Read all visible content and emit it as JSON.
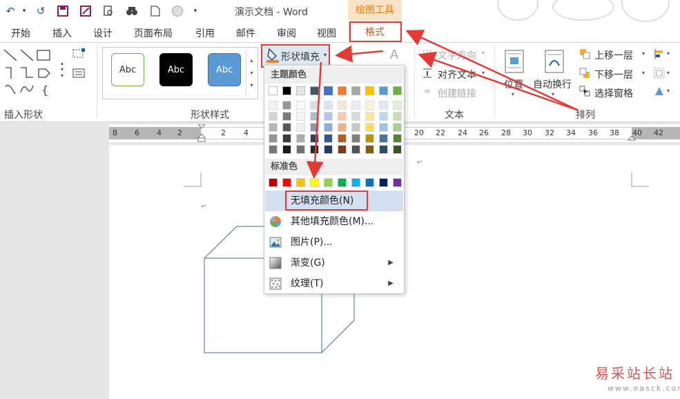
{
  "window": {
    "title": "演示文档 - Word",
    "context_tab_group": "绘图工具"
  },
  "tabs": [
    "开始",
    "插入",
    "设计",
    "页面布局",
    "引用",
    "邮件",
    "审阅",
    "视图",
    "格式"
  ],
  "ribbon": {
    "insert_shapes_label": "插入形状",
    "shape_styles_label": "形状样式",
    "style_samples": [
      "Abc",
      "Abc",
      "Abc"
    ],
    "shape_fill_label": "形状填充",
    "text_direction_label": "文字方向",
    "align_text_label": "对齐文本",
    "create_link_label": "创建链接",
    "text_group_label": "文本",
    "position_label": "位置",
    "wrap_text_label": "自动换行",
    "bring_forward_label": "上移一层",
    "send_backward_label": "下移一层",
    "selection_pane_label": "选择窗格",
    "arrange_group_label": "排列"
  },
  "ruler": {
    "numbers": [
      "8",
      "6",
      "4",
      "2",
      "2",
      "4",
      "20",
      "22",
      "24",
      "26",
      "28",
      "30",
      "32",
      "34",
      "36",
      "38",
      "40",
      "42"
    ]
  },
  "fill_menu": {
    "theme_colors_header": "主题颜色",
    "standard_colors_header": "标准色",
    "theme_top_row": [
      "#ffffff",
      "#000000",
      "#e7e6e6",
      "#44546a",
      "#4472c4",
      "#ed7d31",
      "#a5a5a5",
      "#ffc000",
      "#5b9bd5",
      "#70ad47"
    ],
    "standard_colors": [
      "#c00000",
      "#ff0000",
      "#ffc000",
      "#ffff00",
      "#92d050",
      "#00b050",
      "#00b0f0",
      "#0070c0",
      "#002060",
      "#7030a0"
    ],
    "no_fill": "无填充颜色(N)",
    "more_colors": "其他填充颜色(M)...",
    "picture": "图片(P)...",
    "gradient": "渐变(G)",
    "texture": "纹理(T)"
  },
  "watermark": {
    "text": "易采站长站",
    "url": "www.easck.com"
  },
  "colors": {
    "highlight_red": "#e53935",
    "accent_orange": "#c8561e",
    "cube_line": "#4a6d8c"
  }
}
